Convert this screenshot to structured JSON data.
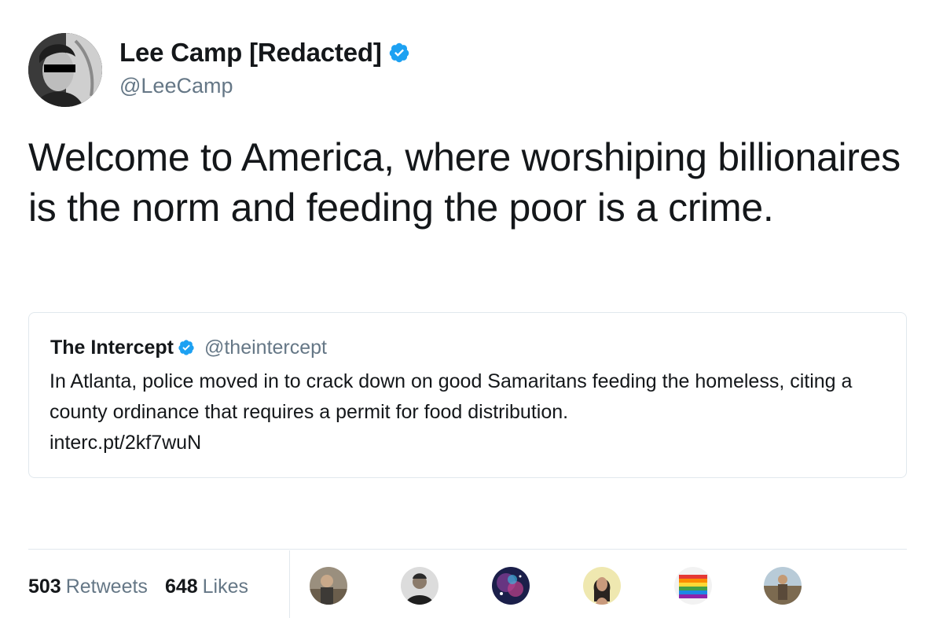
{
  "author": {
    "display_name": "Lee Camp [Redacted]",
    "handle": "@LeeCamp",
    "verified": true,
    "avatar_icon": "user-avatar-photo"
  },
  "tweet": {
    "text": "Welcome to America, where worshiping billionaires is the norm and feeding the poor is a crime."
  },
  "quoted_tweet": {
    "display_name": "The Intercept",
    "handle": "@theintercept",
    "verified": true,
    "text": "In Atlanta, police moved in to crack down on good Samaritans feeding the homeless, citing a county ordinance that requires a permit for food distribution.",
    "link": "interc.pt/2kf7wuN"
  },
  "stats": {
    "retweets_count": "503",
    "retweets_label": "Retweets",
    "likes_count": "648",
    "likes_label": "Likes"
  },
  "likers": [
    {
      "icon": "liker-avatar-1"
    },
    {
      "icon": "liker-avatar-2"
    },
    {
      "icon": "liker-avatar-3"
    },
    {
      "icon": "liker-avatar-4"
    },
    {
      "icon": "liker-avatar-5"
    },
    {
      "icon": "liker-avatar-6"
    }
  ],
  "colors": {
    "text_primary": "#14171a",
    "text_secondary": "#657786",
    "verified_blue": "#1da1f2",
    "border": "#e1e8ed"
  }
}
